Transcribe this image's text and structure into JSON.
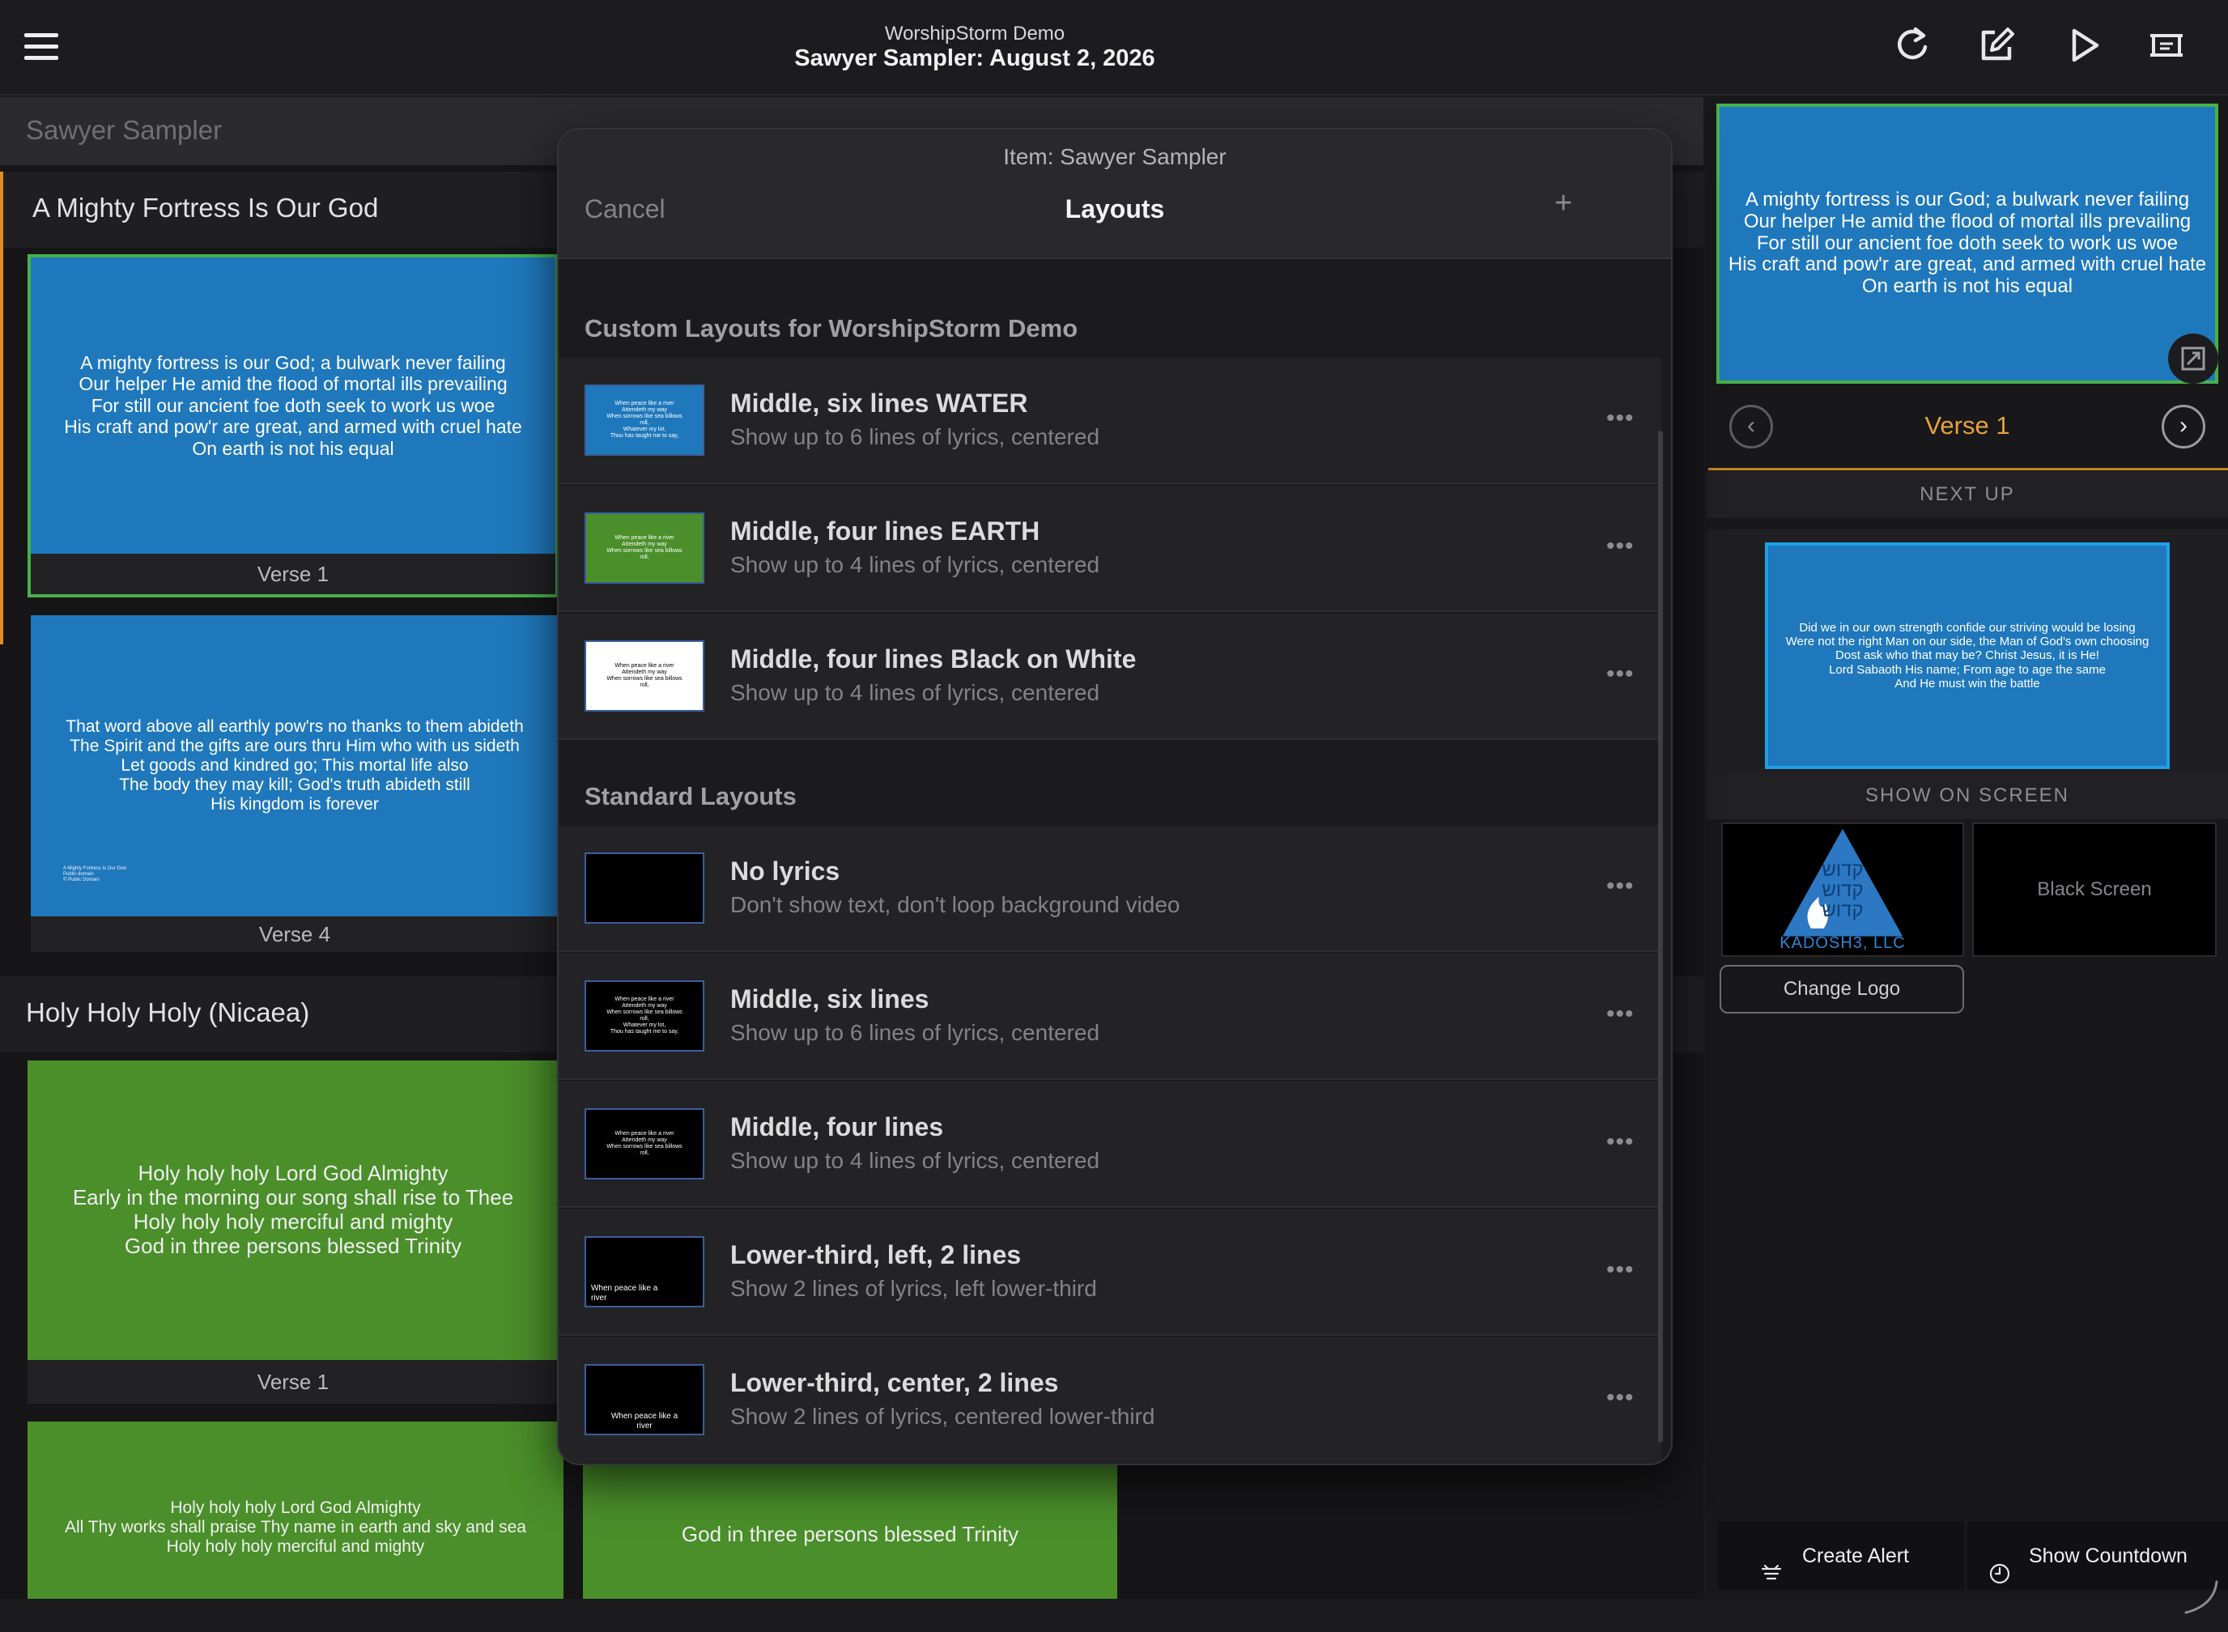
{
  "header": {
    "org_name": "WorshipStorm Demo",
    "service_title": "Sawyer Sampler: August 2, 2026"
  },
  "icons": {
    "menu": "hamburger-icon",
    "refresh": "refresh-icon",
    "edit": "edit-icon",
    "play": "play-icon",
    "screen": "screen-icon"
  },
  "breadcrumb": {
    "label": "Sawyer Sampler"
  },
  "songs": [
    {
      "title": "A Mighty Fortress Is Our God",
      "slides": [
        {
          "label": "Verse 1",
          "lyrics": "A mighty fortress is our God; a bulwark never failing\nOur helper He amid the flood of mortal ills prevailing\nFor still our ancient foe doth seek to work us woe\nHis craft and pow'r are great, and armed with cruel hate\nOn earth is not his equal"
        },
        {
          "label": "Verse 4",
          "lyrics": "That word above all earthly pow'rs no thanks to them abideth\nThe Spirit and the gifts are ours thru Him who with us sideth\nLet goods and kindred go; This mortal life also\nThe body they may kill; God's truth abideth still\nHis kingdom is forever",
          "footer": "A Mighty Fortress Is Our God\nPublic domain\n© Public Domain"
        }
      ]
    },
    {
      "title": "Holy Holy Holy (Nicaea)",
      "slides": [
        {
          "label": "Verse 1",
          "lyrics": "Holy holy holy Lord God Almighty\nEarly in the morning our song shall rise to Thee\nHoly holy holy merciful and mighty\nGod in three persons blessed Trinity"
        },
        {
          "label": "",
          "lyrics": "Holy holy holy Lord God Almighty\nAll Thy works shall praise Thy name in earth and sky and sea\nHoly holy holy merciful and mighty"
        },
        {
          "label": "",
          "lyrics": "God in three persons blessed Trinity"
        }
      ]
    }
  ],
  "modal": {
    "subtitle": "Item: Sawyer Sampler",
    "cancel_label": "Cancel",
    "title": "Layouts",
    "add_label": "+",
    "more_label": "•••",
    "custom_section_title": "Custom Layouts for WorshipStorm Demo",
    "standard_section_title": "Standard Layouts",
    "custom_layouts": [
      {
        "title": "Middle, six lines WATER",
        "desc": "Show up to 6 lines of lyrics, centered",
        "thumb_text": "When peace like a river\nAttendeth my way\nWhen sorrows like sea billows\nroll,\nWhatever my lot,\nThou has taught me to say,",
        "bg": "#1f78bc",
        "fg": "#ffffff"
      },
      {
        "title": "Middle, four lines EARTH",
        "desc": "Show up to 4 lines of lyrics, centered",
        "thumb_text": "When peace like a river\nAttendeth my way\nWhen sorrows like sea billows\nroll,",
        "bg": "#4a8f2a",
        "fg": "#ffffff"
      },
      {
        "title": "Middle, four lines Black on White",
        "desc": "Show up to 4 lines of lyrics, centered",
        "thumb_text": "When peace like a river\nAttendeth my way\nWhen sorrows like sea billows\nroll,",
        "bg": "#ffffff",
        "fg": "#000000"
      }
    ],
    "standard_layouts": [
      {
        "title": "No lyrics",
        "desc": "Don't show text, don't loop background video",
        "thumb_text": ""
      },
      {
        "title": "Middle, six lines",
        "desc": "Show up to 6 lines of lyrics, centered",
        "thumb_text": "When peace like a river\nAttendeth my way\nWhen sorrows like sea billows\nroll,\nWhatever my lot,\nThou has taught me to say,"
      },
      {
        "title": "Middle, four lines",
        "desc": "Show up to 4 lines of lyrics, centered",
        "thumb_text": "When peace like a river\nAttendeth my way\nWhen sorrows like sea billows\nroll,"
      },
      {
        "title": "Lower-third, left, 2 lines",
        "desc": "Show 2 lines of lyrics, left lower-third",
        "thumb_text": "When peace like a\nriver"
      },
      {
        "title": "Lower-third, center, 2 lines",
        "desc": "Show 2 lines of lyrics, centered lower-third",
        "thumb_text": "When peace like a\nriver"
      }
    ]
  },
  "live": {
    "lyrics": "A mighty fortress is our God; a bulwark never failing\nOur helper He amid the flood of mortal ills prevailing\nFor still our ancient foe doth seek to work us woe\nHis craft and pow'r are great, and armed with cruel hate\nOn earth is not his equal",
    "prev_label": "‹",
    "next_label": "›",
    "current_label": "Verse 1"
  },
  "next_up": {
    "heading": "NEXT UP",
    "lyrics": "Did we in our own strength confide our striving would be losing\nWere not the right Man on our side, the Man of God's own choosing\nDost ask who that may be? Christ Jesus, it is He!\nLord Sabaoth His name; From age to age the same\nAnd He must win the battle"
  },
  "show_on_screen": {
    "heading": "SHOW ON SCREEN",
    "logo_hebrew": "קדוש קדוש קדוש",
    "logo_name": "KADOSH3, LLC",
    "black_screen_label": "Black Screen",
    "change_logo_label": "Change Logo"
  },
  "bottom": {
    "create_alert_label": "Create Alert",
    "show_countdown_label": "Show Countdown"
  },
  "colors": {
    "accent_orange": "#e08e22",
    "live_green": "#47b14a",
    "slide_blue": "#1f78bc",
    "slide_green": "#4a8f2a"
  }
}
